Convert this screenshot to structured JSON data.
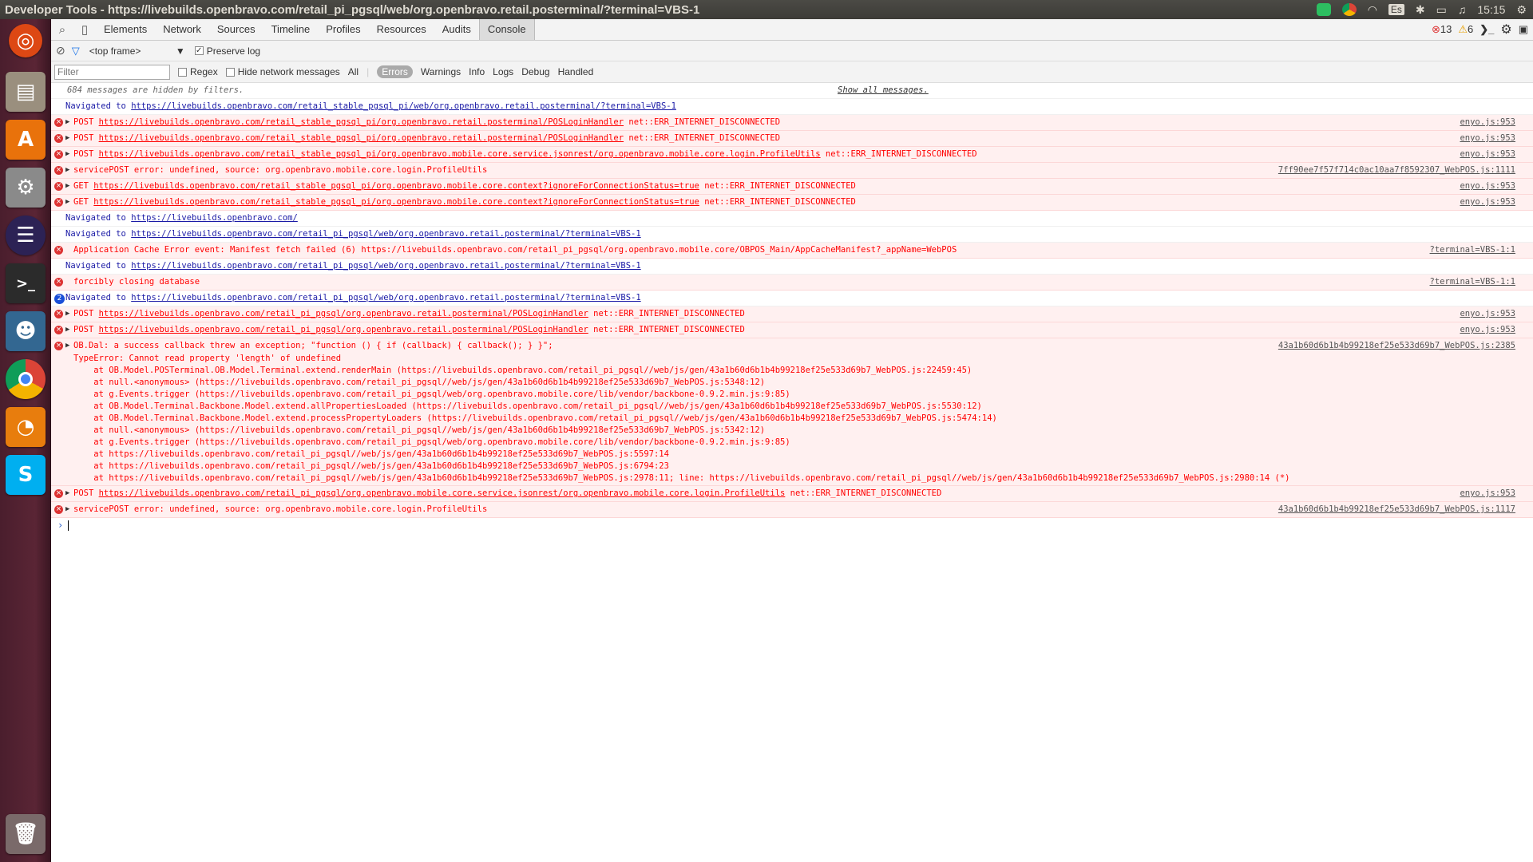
{
  "window": {
    "title": "Developer Tools - https://livebuilds.openbravo.com/retail_pi_pgsql/web/org.openbravo.retail.posterminal/?terminal=VBS-1",
    "clock": "15:15",
    "keyboard": "Es"
  },
  "launcher": [
    "ubuntu-logo",
    "files",
    "software-center",
    "system-settings",
    "eclipse",
    "terminal",
    "pgadmin",
    "chrome",
    "blender",
    "skype",
    "trash"
  ],
  "toolbar": {
    "tabs": [
      "Elements",
      "Network",
      "Sources",
      "Timeline",
      "Profiles",
      "Resources",
      "Audits",
      "Console"
    ],
    "active_tab": "Console",
    "error_count": "13",
    "warning_count": "6"
  },
  "console_bar": {
    "frame": "<top frame>",
    "preserve_log": "Preserve log"
  },
  "filter_bar": {
    "placeholder": "Filter",
    "regex": "Regex",
    "hide_network": "Hide network messages",
    "levels": [
      "All",
      "Errors",
      "Warnings",
      "Info",
      "Logs",
      "Debug",
      "Handled"
    ],
    "active_level": "Errors"
  },
  "hidden_note": "684 messages are hidden by filters.",
  "show_all": "Show all messages.",
  "messages": [
    {
      "type": "nav",
      "prefix": "Navigated to ",
      "url": "https://livebuilds.openbravo.com/retail_stable_pgsql_pi/web/org.openbravo.retail.posterminal/?terminal=VBS-1",
      "suffix": "",
      "source": ""
    },
    {
      "type": "err",
      "tri": true,
      "prefix": "POST ",
      "url": "https://livebuilds.openbravo.com/retail_stable_pgsql_pi/org.openbravo.retail.posterminal/POSLoginHandler",
      "suffix": " net::ERR_INTERNET_DISCONNECTED",
      "source": "enyo.js:953"
    },
    {
      "type": "err",
      "tri": true,
      "prefix": "POST ",
      "url": "https://livebuilds.openbravo.com/retail_stable_pgsql_pi/org.openbravo.retail.posterminal/POSLoginHandler",
      "suffix": " net::ERR_INTERNET_DISCONNECTED",
      "source": "enyo.js:953"
    },
    {
      "type": "err",
      "tri": true,
      "prefix": "POST ",
      "url": "https://livebuilds.openbravo.com/retail_stable_pgsql_pi/org.openbravo.mobile.core.service.jsonrest/org.openbravo.mobile.core.login.ProfileUtils",
      "suffix": " net::ERR_INTERNET_DISCONNECTED",
      "source": "enyo.js:953"
    },
    {
      "type": "err",
      "tri": true,
      "prefix": "servicePOST error: undefined, source: org.openbravo.mobile.core.login.ProfileUtils",
      "url": "",
      "suffix": "",
      "source": "7ff90ee7f57f714c0ac10aa7f8592307_WebPOS.js:1111"
    },
    {
      "type": "err",
      "tri": true,
      "prefix": "GET ",
      "url": "https://livebuilds.openbravo.com/retail_stable_pgsql_pi/org.openbravo.mobile.core.context?ignoreForConnectionStatus=true",
      "suffix": " net::ERR_INTERNET_DISCONNECTED",
      "source": "enyo.js:953"
    },
    {
      "type": "err",
      "tri": true,
      "prefix": "GET ",
      "url": "https://livebuilds.openbravo.com/retail_stable_pgsql_pi/org.openbravo.mobile.core.context?ignoreForConnectionStatus=true",
      "suffix": " net::ERR_INTERNET_DISCONNECTED",
      "source": "enyo.js:953"
    },
    {
      "type": "nav",
      "prefix": "Navigated to ",
      "url": "https://livebuilds.openbravo.com/",
      "suffix": "",
      "source": ""
    },
    {
      "type": "nav",
      "prefix": "Navigated to ",
      "url": "https://livebuilds.openbravo.com/retail_pi_pgsql/web/org.openbravo.retail.posterminal/?terminal=VBS-1",
      "suffix": "",
      "source": ""
    },
    {
      "type": "err",
      "tri": false,
      "prefix": "Application Cache Error event: Manifest fetch failed (6) https://livebuilds.openbravo.com/retail_pi_pgsql/org.openbravo.mobile.core/OBPOS_Main/AppCacheManifest?_appName=WebPOS",
      "url": "",
      "suffix": "",
      "source": "?terminal=VBS-1:1"
    },
    {
      "type": "nav",
      "prefix": "Navigated to ",
      "url": "https://livebuilds.openbravo.com/retail_pi_pgsql/web/org.openbravo.retail.posterminal/?terminal=VBS-1",
      "suffix": "",
      "source": ""
    },
    {
      "type": "err",
      "tri": false,
      "prefix": "forcibly closing database",
      "url": "",
      "suffix": "",
      "source": "?terminal=VBS-1:1"
    },
    {
      "type": "nav",
      "count": "2",
      "prefix": "Navigated to ",
      "url": "https://livebuilds.openbravo.com/retail_pi_pgsql/web/org.openbravo.retail.posterminal/?terminal=VBS-1",
      "suffix": "",
      "source": ""
    },
    {
      "type": "err",
      "tri": true,
      "prefix": "POST ",
      "url": "https://livebuilds.openbravo.com/retail_pi_pgsql/org.openbravo.retail.posterminal/POSLoginHandler",
      "suffix": " net::ERR_INTERNET_DISCONNECTED",
      "source": "enyo.js:953"
    },
    {
      "type": "err",
      "tri": true,
      "prefix": "POST ",
      "url": "https://livebuilds.openbravo.com/retail_pi_pgsql/org.openbravo.retail.posterminal/POSLoginHandler",
      "suffix": " net::ERR_INTERNET_DISCONNECTED",
      "source": "enyo.js:953"
    },
    {
      "type": "err",
      "tri": true,
      "prefix": "OB.Dal: a success callback threw an exception; \"function () { if (callback) { callback(); } }\";",
      "url": "",
      "suffix": "",
      "source": "43a1b60d6b1b4b99218ef25e533d69b7_WebPOS.js:2385",
      "stack": [
        "TypeError: Cannot read property 'length' of undefined",
        "    at OB.Model.POSTerminal.OB.Model.Terminal.extend.renderMain (https://livebuilds.openbravo.com/retail_pi_pgsql//web/js/gen/43a1b60d6b1b4b99218ef25e533d69b7_WebPOS.js:22459:45)",
        "    at null.<anonymous> (https://livebuilds.openbravo.com/retail_pi_pgsql//web/js/gen/43a1b60d6b1b4b99218ef25e533d69b7_WebPOS.js:5348:12)",
        "    at g.Events.trigger (https://livebuilds.openbravo.com/retail_pi_pgsql/web/org.openbravo.mobile.core/lib/vendor/backbone-0.9.2.min.js:9:85)",
        "    at OB.Model.Terminal.Backbone.Model.extend.allPropertiesLoaded (https://livebuilds.openbravo.com/retail_pi_pgsql//web/js/gen/43a1b60d6b1b4b99218ef25e533d69b7_WebPOS.js:5530:12)",
        "    at OB.Model.Terminal.Backbone.Model.extend.processPropertyLoaders (https://livebuilds.openbravo.com/retail_pi_pgsql//web/js/gen/43a1b60d6b1b4b99218ef25e533d69b7_WebPOS.js:5474:14)",
        "    at null.<anonymous> (https://livebuilds.openbravo.com/retail_pi_pgsql//web/js/gen/43a1b60d6b1b4b99218ef25e533d69b7_WebPOS.js:5342:12)",
        "    at g.Events.trigger (https://livebuilds.openbravo.com/retail_pi_pgsql/web/org.openbravo.mobile.core/lib/vendor/backbone-0.9.2.min.js:9:85)",
        "    at https://livebuilds.openbravo.com/retail_pi_pgsql//web/js/gen/43a1b60d6b1b4b99218ef25e533d69b7_WebPOS.js:5597:14",
        "    at https://livebuilds.openbravo.com/retail_pi_pgsql//web/js/gen/43a1b60d6b1b4b99218ef25e533d69b7_WebPOS.js:6794:23",
        "    at https://livebuilds.openbravo.com/retail_pi_pgsql//web/js/gen/43a1b60d6b1b4b99218ef25e533d69b7_WebPOS.js:2978:11; line: https://livebuilds.openbravo.com/retail_pi_pgsql//web/js/gen/43a1b60d6b1b4b99218ef25e533d69b7_WebPOS.js:2980:14 (*)"
      ]
    },
    {
      "type": "err",
      "tri": true,
      "prefix": "POST ",
      "url": "https://livebuilds.openbravo.com/retail_pi_pgsql/org.openbravo.mobile.core.service.jsonrest/org.openbravo.mobile.core.login.ProfileUtils",
      "suffix": " net::ERR_INTERNET_DISCONNECTED",
      "source": "enyo.js:953"
    },
    {
      "type": "err",
      "tri": true,
      "prefix": "servicePOST error: undefined, source: org.openbravo.mobile.core.login.ProfileUtils",
      "url": "",
      "suffix": "",
      "source": "43a1b60d6b1b4b99218ef25e533d69b7_WebPOS.js:1117"
    }
  ],
  "colors": {
    "error": "#ff0000",
    "error_bg": "#fff0f0",
    "nav": "#1a1aa6",
    "accent_tab": "#dcdcdc"
  }
}
